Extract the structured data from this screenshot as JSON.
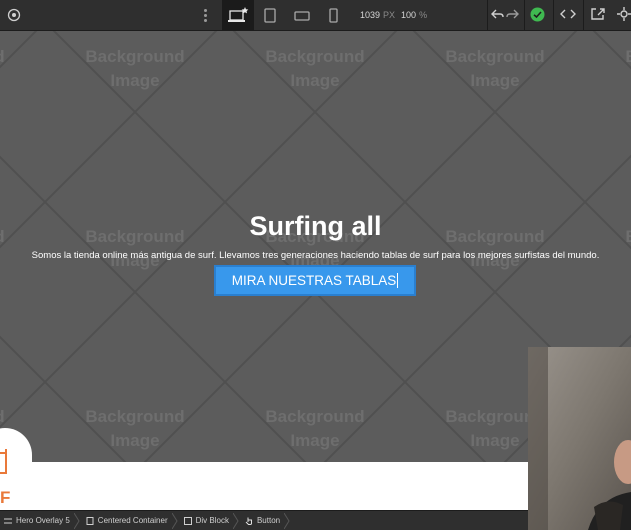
{
  "toolbar": {
    "icons": {
      "preview": "eye-icon",
      "menu": "more-vertical-icon",
      "breakpoints": [
        "desktop-base-icon",
        "tablet-icon",
        "mobile-landscape-icon",
        "mobile-portrait-icon"
      ],
      "undo": "undo-icon",
      "redo": "redo-icon",
      "status": "check-circle-icon",
      "code": "code-icon",
      "export": "export-icon",
      "settings": "gear-icon"
    },
    "canvas_width": "1039",
    "width_unit": "PX",
    "zoom": "100",
    "zoom_unit": "%"
  },
  "canvas": {
    "background_placeholder": "Background Image",
    "hero": {
      "title": "Surfing all",
      "subtitle": "Somos la tienda online más antigua de surf. Llevamos tres generaciones haciendo tablas de surf para los mejores surfistas del mundo.",
      "button_label": "MIRA NUESTRAS TABLAS"
    },
    "logo_fragment": "F"
  },
  "breadcrumbs": [
    {
      "label": "Hero Overlay 5",
      "icon": "section-icon"
    },
    {
      "label": "Centered Container",
      "icon": "container-icon"
    },
    {
      "label": "Div Block",
      "icon": "div-block-icon"
    },
    {
      "label": "Button",
      "icon": "hand-pointer-icon"
    }
  ],
  "colors": {
    "toolbar_bg": "#2f2f2f",
    "canvas_overlay": "#5c5c5c",
    "button_blue": "#3898ec",
    "status_green": "#3fb950",
    "logo_orange": "#e9793a"
  }
}
